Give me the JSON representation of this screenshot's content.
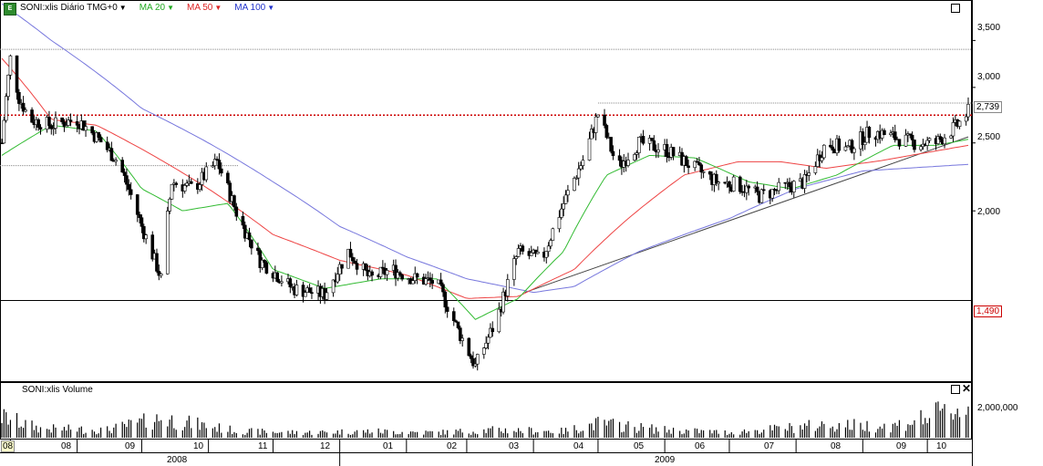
{
  "toolbar": {
    "symbol_label": "SONI:xlis Diário TMG+0",
    "icon": "chart-app-icon",
    "studies": [
      {
        "label": "MA 20",
        "color": "#22aa22"
      },
      {
        "label": "MA 50",
        "color": "#dd2222"
      },
      {
        "label": "MA 100",
        "color": "#2233cc"
      }
    ]
  },
  "volume_pane": {
    "title": "SONI:xlis Volume",
    "axis_label": "2,000,000"
  },
  "price_axis": {
    "ticks": [
      "3,500",
      "3,000",
      "2,500",
      "2,000"
    ],
    "markers": [
      {
        "label": "2,739",
        "color": "#cc0000",
        "style": "dotted"
      },
      {
        "label": "1,490",
        "color": "#000000",
        "style": "solid"
      }
    ]
  },
  "time_axis": {
    "months": [
      "08",
      "08",
      "09",
      "10",
      "11",
      "12",
      "01",
      "02",
      "03",
      "04",
      "05",
      "06",
      "07",
      "08",
      "09",
      "10"
    ],
    "years": [
      "2008",
      "2009"
    ]
  },
  "chart_data": {
    "type": "candlestick",
    "title": "SONI:xlis Diário TMG+0",
    "y_scale": "log",
    "ylim": [
      1150,
      3950
    ],
    "x_range": [
      "2008-07-28",
      "2009-10-20"
    ],
    "levels": [
      {
        "name": "resistance-high",
        "value": 3400,
        "color": "#888888"
      },
      {
        "name": "last-price",
        "value": 2739,
        "color": "#cc0000"
      },
      {
        "name": "resistance-2009",
        "value": 2850,
        "color": "#888888"
      },
      {
        "name": "level-2008",
        "value": 2320,
        "color": "#888888"
      },
      {
        "name": "support",
        "value": 1490,
        "color": "#000000"
      }
    ],
    "price_path": [
      [
        "2008-07-28",
        2500
      ],
      [
        "2008-08-01",
        3300
      ],
      [
        "2008-08-05",
        2900
      ],
      [
        "2008-08-10",
        2700
      ],
      [
        "2008-08-20",
        2650
      ],
      [
        "2008-09-01",
        2700
      ],
      [
        "2008-09-10",
        2550
      ],
      [
        "2008-09-20",
        2350
      ],
      [
        "2008-10-01",
        1900
      ],
      [
        "2008-10-10",
        1600
      ],
      [
        "2008-10-15",
        2200
      ],
      [
        "2008-10-25",
        2150
      ],
      [
        "2008-11-05",
        2350
      ],
      [
        "2008-11-15",
        1950
      ],
      [
        "2008-11-25",
        1700
      ],
      [
        "2008-12-10",
        1550
      ],
      [
        "2008-12-25",
        1520
      ],
      [
        "2009-01-05",
        1750
      ],
      [
        "2009-01-15",
        1600
      ],
      [
        "2009-01-25",
        1650
      ],
      [
        "2009-02-05",
        1600
      ],
      [
        "2009-02-15",
        1580
      ],
      [
        "2009-02-25",
        1350
      ],
      [
        "2009-03-05",
        1200
      ],
      [
        "2009-03-15",
        1400
      ],
      [
        "2009-03-25",
        1750
      ],
      [
        "2009-04-05",
        1700
      ],
      [
        "2009-04-15",
        2050
      ],
      [
        "2009-04-25",
        2400
      ],
      [
        "2009-05-01",
        2750
      ],
      [
        "2009-05-10",
        2300
      ],
      [
        "2009-05-20",
        2500
      ],
      [
        "2009-06-01",
        2450
      ],
      [
        "2009-06-15",
        2300
      ],
      [
        "2009-06-25",
        2200
      ],
      [
        "2009-07-05",
        2180
      ],
      [
        "2009-07-15",
        2100
      ],
      [
        "2009-07-25",
        2150
      ],
      [
        "2009-08-05",
        2200
      ],
      [
        "2009-08-15",
        2500
      ],
      [
        "2009-08-25",
        2450
      ],
      [
        "2009-09-05",
        2600
      ],
      [
        "2009-09-15",
        2550
      ],
      [
        "2009-09-25",
        2500
      ],
      [
        "2009-10-05",
        2500
      ],
      [
        "2009-10-15",
        2650
      ],
      [
        "2009-10-20",
        2770
      ]
    ],
    "ma20": [
      [
        "2008-07-28",
        2400
      ],
      [
        "2008-08-20",
        2650
      ],
      [
        "2008-09-10",
        2600
      ],
      [
        "2008-10-01",
        2150
      ],
      [
        "2008-10-20",
        2000
      ],
      [
        "2008-11-10",
        2050
      ],
      [
        "2008-12-01",
        1650
      ],
      [
        "2008-12-25",
        1550
      ],
      [
        "2009-01-20",
        1600
      ],
      [
        "2009-02-15",
        1600
      ],
      [
        "2009-03-05",
        1400
      ],
      [
        "2009-03-25",
        1500
      ],
      [
        "2009-04-15",
        1750
      ],
      [
        "2009-05-05",
        2250
      ],
      [
        "2009-05-25",
        2400
      ],
      [
        "2009-06-15",
        2380
      ],
      [
        "2009-07-10",
        2200
      ],
      [
        "2009-07-30",
        2150
      ],
      [
        "2009-08-20",
        2250
      ],
      [
        "2009-09-15",
        2480
      ],
      [
        "2009-10-05",
        2480
      ],
      [
        "2009-10-20",
        2530
      ]
    ],
    "ma50": [
      [
        "2008-07-28",
        3300
      ],
      [
        "2008-08-20",
        2700
      ],
      [
        "2008-09-10",
        2650
      ],
      [
        "2008-10-01",
        2450
      ],
      [
        "2008-11-01",
        2150
      ],
      [
        "2008-12-01",
        1850
      ],
      [
        "2009-01-01",
        1700
      ],
      [
        "2009-02-01",
        1620
      ],
      [
        "2009-03-01",
        1500
      ],
      [
        "2009-03-25",
        1510
      ],
      [
        "2009-04-20",
        1650
      ],
      [
        "2009-05-15",
        1950
      ],
      [
        "2009-06-10",
        2250
      ],
      [
        "2009-07-05",
        2350
      ],
      [
        "2009-07-25",
        2350
      ],
      [
        "2009-08-15",
        2300
      ],
      [
        "2009-09-10",
        2360
      ],
      [
        "2009-10-20",
        2480
      ]
    ],
    "ma100": [
      [
        "2008-07-28",
        3950
      ],
      [
        "2008-08-20",
        3500
      ],
      [
        "2008-10-01",
        2800
      ],
      [
        "2008-11-01",
        2500
      ],
      [
        "2008-12-01",
        2200
      ],
      [
        "2009-01-01",
        1900
      ],
      [
        "2009-02-01",
        1720
      ],
      [
        "2009-03-01",
        1600
      ],
      [
        "2009-04-01",
        1530
      ],
      [
        "2009-04-20",
        1560
      ],
      [
        "2009-05-20",
        1750
      ],
      [
        "2009-07-01",
        1950
      ],
      [
        "2009-08-01",
        2150
      ],
      [
        "2009-09-01",
        2280
      ],
      [
        "2009-10-20",
        2330
      ]
    ],
    "trendline": [
      [
        "2009-03-28",
        1530
      ],
      [
        "2009-10-20",
        2550
      ]
    ],
    "volume_scale": [
      0,
      2600000
    ],
    "volume_path": [
      [
        "2008-07-28",
        1600000
      ],
      [
        "2008-08-15",
        700000
      ],
      [
        "2008-09-15",
        600000
      ],
      [
        "2008-10-10",
        1500000
      ],
      [
        "2008-11-15",
        500000
      ],
      [
        "2008-12-15",
        400000
      ],
      [
        "2009-01-15",
        500000
      ],
      [
        "2009-02-15",
        400000
      ],
      [
        "2009-03-15",
        600000
      ],
      [
        "2009-04-15",
        500000
      ],
      [
        "2009-05-01",
        1100000
      ],
      [
        "2009-06-01",
        600000
      ],
      [
        "2009-07-01",
        400000
      ],
      [
        "2009-08-15",
        1000000
      ],
      [
        "2009-09-15",
        900000
      ],
      [
        "2009-10-15",
        2200000
      ]
    ]
  }
}
